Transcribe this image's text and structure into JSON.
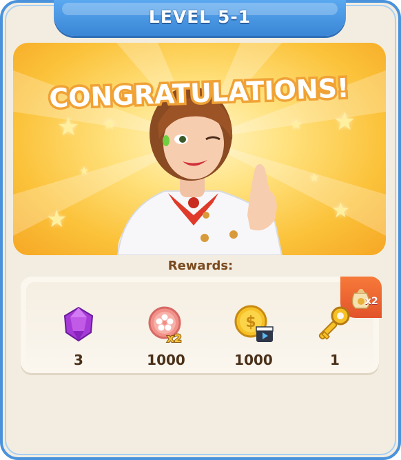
{
  "header": {
    "title": "LEVEL 5-1"
  },
  "banner": {
    "headline": "CONGRATULATIONS!"
  },
  "rewards": {
    "label": "Rewards:",
    "bonus_badge": {
      "icon": "money-bag-icon",
      "multiplier": "x2"
    },
    "items": [
      {
        "icon": "gem-icon",
        "value": "3"
      },
      {
        "icon": "sakura-token-icon",
        "value": "1000",
        "multiplier": "x2"
      },
      {
        "icon": "coin-video-icon",
        "value": "1000"
      },
      {
        "icon": "key-icon",
        "value": "1"
      }
    ]
  }
}
